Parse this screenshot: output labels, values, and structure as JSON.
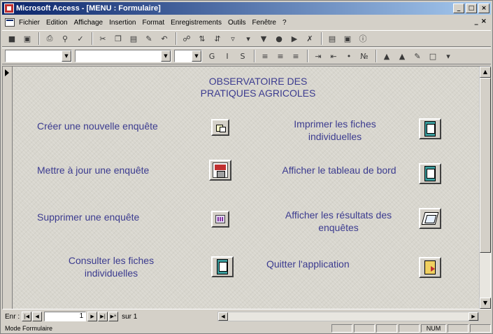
{
  "window": {
    "title": "Microsoft Access - [MENU : Formulaire]",
    "controls": [
      "_",
      "□",
      "×"
    ]
  },
  "menubar": {
    "items": [
      "Fichier",
      "Edition",
      "Affichage",
      "Insertion",
      "Format",
      "Enregistrements",
      "Outils",
      "Fenêtre",
      "?"
    ],
    "right": [
      "_",
      "×"
    ]
  },
  "toolbar": {
    "font_style_buttons": [
      "G",
      "I",
      "S"
    ]
  },
  "form": {
    "title_line1": "OBSERVATOIRE DES",
    "title_line2": "PRATIQUES AGRICOLES",
    "buttons": [
      {
        "label": "Créer une nouvelle enquête",
        "icon": "new-survey-icon"
      },
      {
        "label": "Mettre à jour une enquête",
        "icon": "update-survey-icon"
      },
      {
        "label": "Supprimer une enquête",
        "icon": "delete-survey-icon"
      },
      {
        "label": "Consulter les fiches individuelles",
        "icon": "form-icon"
      },
      {
        "label": "Imprimer les fiches individuelles",
        "icon": "form-icon"
      },
      {
        "label": "Afficher le tableau de bord",
        "icon": "form-icon"
      },
      {
        "label": "Afficher les résultats des enquêtes",
        "icon": "results-icon"
      },
      {
        "label": "Quitter l'application",
        "icon": "exit-door-icon"
      }
    ]
  },
  "navigation": {
    "record_label": "Enr :",
    "current_record": "1",
    "of_label": "sur 1"
  },
  "status": {
    "mode": "Mode Formulaire",
    "num": "NUM"
  },
  "colors": {
    "label_text": "#3b3b8f",
    "title_bar_start": "#0a246a",
    "title_bar_end": "#a6caf0"
  }
}
